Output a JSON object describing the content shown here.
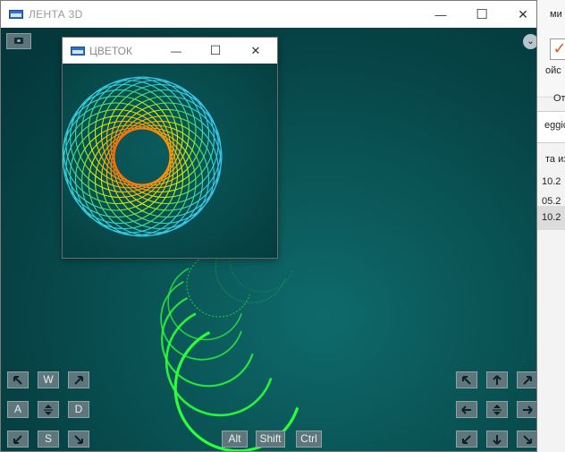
{
  "background_window": {
    "ribbon_text": "ми",
    "menu_text": "ойс",
    "tab_text": "От",
    "search_value": "eggic",
    "column_text": "та из",
    "rows": [
      "10.2",
      "05.2",
      "10.2"
    ]
  },
  "main_window": {
    "title": "ЛЕНТА 3D",
    "minimize_glyph": "—",
    "maximize_glyph": "☐",
    "close_glyph": "✕",
    "menu_glyph": "⌄"
  },
  "child_window": {
    "title": "ЦВЕТОК",
    "minimize_glyph": "—",
    "maximize_glyph": "☐",
    "close_glyph": "✕"
  },
  "controls_left": {
    "up_left": "up-left-arrow-icon",
    "forward": "W",
    "up_right": "up-right-arrow-icon",
    "left": "A",
    "updown": "up-down-icon",
    "right": "D",
    "down_left": "down-left-arrow-icon",
    "back": "S",
    "down_right": "down-right-arrow-icon"
  },
  "controls_modifiers": {
    "alt": "Alt",
    "shift": "Shift",
    "ctrl": "Ctrl"
  },
  "controls_right": [
    "up-left-arrow-icon",
    "up-arrow-icon",
    "up-right-arrow-icon",
    "left-arrow-icon",
    "up-down-icon",
    "right-arrow-icon",
    "down-left-arrow-icon",
    "down-arrow-icon",
    "down-right-arrow-icon"
  ],
  "colors": {
    "stage_bg": "#064447",
    "ribbon_green": "#2cff3a",
    "flower_cyan": "#35d7e8",
    "flower_orange": "#ff5a1a"
  }
}
